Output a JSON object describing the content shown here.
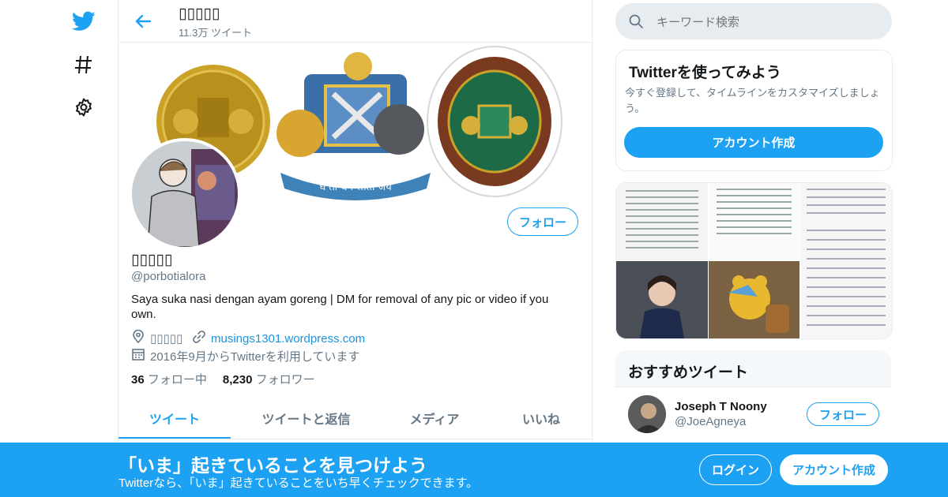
{
  "nav": {
    "logo_icon": "twitter-bird-icon",
    "explore_icon": "hashtag-icon",
    "settings_icon": "gear-icon"
  },
  "header": {
    "name": "▯▯▯▯▯",
    "tweet_count": "11.3万 ツイート"
  },
  "profile": {
    "name": "▯▯▯▯▯",
    "handle": "@porbotialora",
    "bio": "Saya suka nasi dengan ayam goreng | DM for removal of any pic or video if you own.",
    "location": "▯▯▯▯▯",
    "url": "musings1301.wordpress.com",
    "joined": "2016年9月からTwitterを利用しています",
    "following_count": "36",
    "following_label": "フォロー中",
    "followers_count": "8,230",
    "followers_label": "フォロワー",
    "follow_label": "フォロー",
    "banner_motto": "ध तो धर्म स्ततो जय"
  },
  "tabs": [
    {
      "label": "ツイート",
      "active": true
    },
    {
      "label": "ツイートと返信",
      "active": false
    },
    {
      "label": "メディア",
      "active": false
    },
    {
      "label": "いいね",
      "active": false
    }
  ],
  "search": {
    "placeholder": "キーワード検索"
  },
  "signup_card": {
    "title": "Twitterを使ってみよう",
    "description": "今すぐ登録して、タイムラインをカスタマイズしましょう。",
    "button": "アカウント作成"
  },
  "recommended": {
    "title": "おすすめツイート",
    "user": {
      "name": "Joseph T Noony",
      "handle": "@JoeAgneya",
      "follow_label": "フォロー"
    }
  },
  "bottom_bar": {
    "title": "「いま」起きていることを見つけよう",
    "subtitle": "Twitterなら、「いま」起きていることをいち早くチェックできます。",
    "login": "ログイン",
    "signup": "アカウント作成"
  },
  "colors": {
    "accent": "#1da1f2",
    "link": "#1b95e0",
    "muted": "#657786",
    "border": "#e6ecf0"
  }
}
